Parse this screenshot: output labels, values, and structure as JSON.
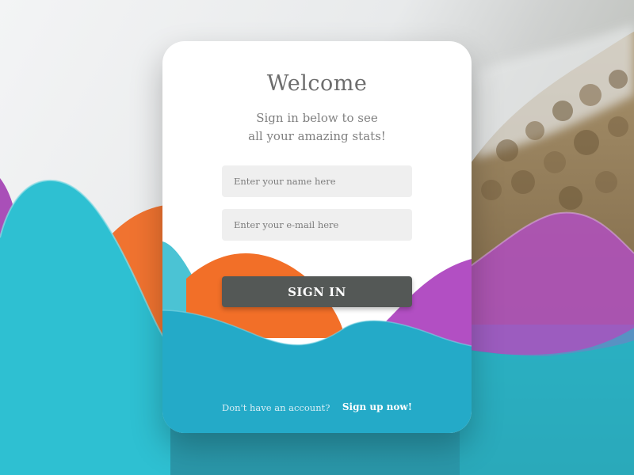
{
  "login_card": {
    "title": "Welcome",
    "subtitle_line1": "Sign in below to see",
    "subtitle_line2": "all your amazing stats!",
    "name_placeholder": "Enter your name here",
    "email_placeholder": "Enter your e-mail here",
    "sign_in_label": "SIGN IN",
    "no_account_text": "Don't have an account?",
    "sign_up_label": "Sign up now!"
  },
  "colors": {
    "teal": "#2db5cc",
    "orange": "#f07330",
    "purple": "#a94fb8",
    "button": "#545856",
    "field": "#efefef"
  }
}
